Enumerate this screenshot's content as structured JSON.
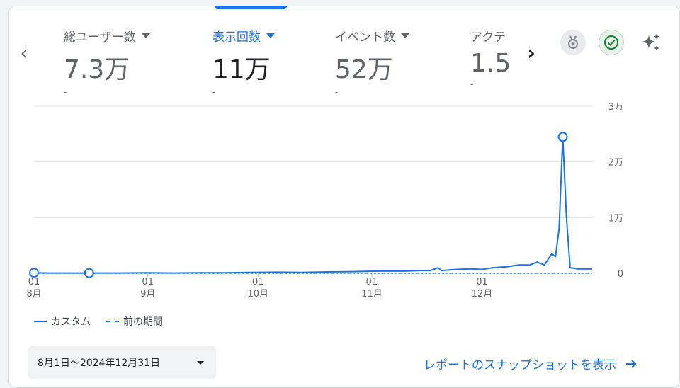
{
  "metrics": [
    {
      "label": "総ユーザー数",
      "value": "7.3万",
      "sub": "-"
    },
    {
      "label": "表示回数",
      "value": "11万",
      "sub": "-",
      "active": true
    },
    {
      "label": "イベント数",
      "value": "52万",
      "sub": "-"
    },
    {
      "label": "アクテ",
      "value": "1.5",
      "sub": "-"
    }
  ],
  "icons": {
    "prev": "chevron-left-icon",
    "next": "chevron-right-icon",
    "medal": "medal-icon",
    "check": "check-circle-icon",
    "sparkle": "sparkle-icon"
  },
  "colors": {
    "accent": "#1a73e8",
    "check_green": "#188038"
  },
  "date_range": "8月1日〜2024年12月31日",
  "snapshot_link": "レポートのスナップショットを表示",
  "chart_data": {
    "type": "line",
    "xlabel": "",
    "ylabel": "",
    "ylim": [
      0,
      30000
    ],
    "y_ticks": [
      {
        "value": 30000,
        "label": "3万"
      },
      {
        "value": 20000,
        "label": "2万"
      },
      {
        "value": 10000,
        "label": "1万"
      },
      {
        "value": 0,
        "label": "0"
      }
    ],
    "x_range": [
      "2024-08-01",
      "2024-12-31"
    ],
    "x_ticks": [
      {
        "date": "2024-08-01",
        "day": "01",
        "month": "8月"
      },
      {
        "date": "2024-09-01",
        "day": "01",
        "month": "9月"
      },
      {
        "date": "2024-10-01",
        "day": "01",
        "month": "10月"
      },
      {
        "date": "2024-11-01",
        "day": "01",
        "month": "11月"
      },
      {
        "date": "2024-12-01",
        "day": "01",
        "month": "12月"
      }
    ],
    "grid": true,
    "legend_position": "bottom-left",
    "series": [
      {
        "name": "カスタム",
        "style": "solid",
        "points": [
          [
            "2024-08-01",
            100
          ],
          [
            "2024-08-05",
            50
          ],
          [
            "2024-08-10",
            50
          ],
          [
            "2024-08-16",
            50
          ],
          [
            "2024-08-24",
            50
          ],
          [
            "2024-09-01",
            100
          ],
          [
            "2024-09-08",
            50
          ],
          [
            "2024-09-15",
            100
          ],
          [
            "2024-09-22",
            100
          ],
          [
            "2024-09-29",
            150
          ],
          [
            "2024-10-06",
            200
          ],
          [
            "2024-10-13",
            150
          ],
          [
            "2024-10-20",
            250
          ],
          [
            "2024-10-27",
            300
          ],
          [
            "2024-11-03",
            400
          ],
          [
            "2024-11-10",
            400
          ],
          [
            "2024-11-14",
            500
          ],
          [
            "2024-11-17",
            500
          ],
          [
            "2024-11-19",
            1000
          ],
          [
            "2024-11-20",
            500
          ],
          [
            "2024-11-24",
            700
          ],
          [
            "2024-11-28",
            800
          ],
          [
            "2024-12-01",
            700
          ],
          [
            "2024-12-04",
            1000
          ],
          [
            "2024-12-08",
            1200
          ],
          [
            "2024-12-11",
            1500
          ],
          [
            "2024-12-14",
            1500
          ],
          [
            "2024-12-16",
            2000
          ],
          [
            "2024-12-18",
            1500
          ],
          [
            "2024-12-19",
            2500
          ],
          [
            "2024-12-20",
            3500
          ],
          [
            "2024-12-21",
            3000
          ],
          [
            "2024-12-22",
            8000
          ],
          [
            "2024-12-23",
            24500
          ],
          [
            "2024-12-24",
            10000
          ],
          [
            "2024-12-25",
            1000
          ],
          [
            "2024-12-27",
            800
          ],
          [
            "2024-12-31",
            800
          ]
        ],
        "markers": [
          [
            "2024-08-01",
            100
          ],
          [
            "2024-08-16",
            50
          ],
          [
            "2024-12-23",
            24500
          ]
        ]
      },
      {
        "name": "前の期間",
        "style": "dashed",
        "points": [
          [
            "2024-08-01",
            0
          ],
          [
            "2024-12-31",
            0
          ]
        ]
      }
    ]
  }
}
